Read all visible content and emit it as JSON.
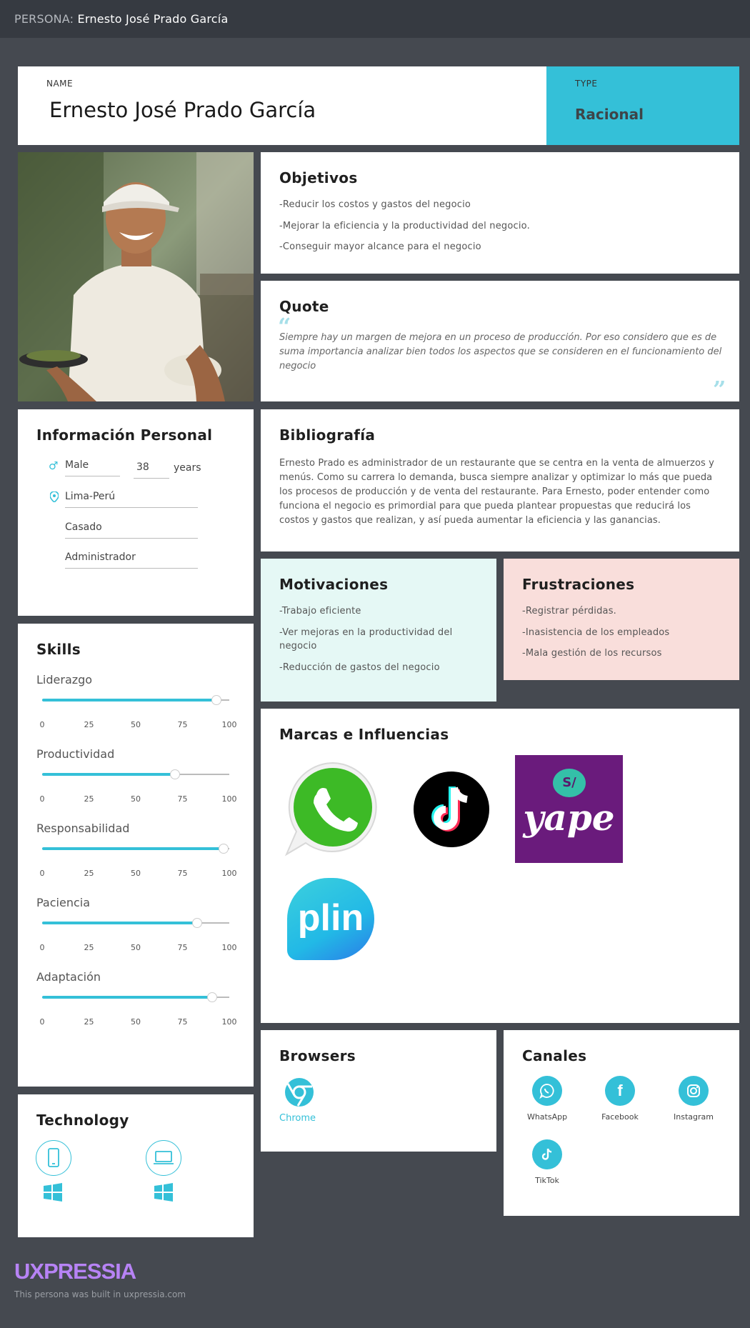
{
  "header": {
    "prefix": "PERSONA:",
    "persona_name": "Ernesto José Prado García"
  },
  "name_card": {
    "label": "NAME",
    "value": "Ernesto José Prado García"
  },
  "type_card": {
    "label": "TYPE",
    "value": "Racional",
    "color": "#34c0d8"
  },
  "objetivos": {
    "title": "Objetivos",
    "items": [
      "-Reducir los costos y gastos del negocio",
      "-Mejorar la eficiencia y la productividad del negocio.",
      "-Conseguir mayor alcance para el negocio"
    ]
  },
  "quote": {
    "title": "Quote",
    "text": "Siempre hay un margen de mejora en un proceso de producción. Por eso considero que es de suma importancia analizar bien todos los aspectos que se consideren en el funcionamiento del negocio"
  },
  "info": {
    "title": "Información Personal",
    "gender": "Male",
    "age": "38",
    "age_unit": "years",
    "location": "Lima-Perú",
    "marital_status": "Casado",
    "occupation": "Administrador"
  },
  "bio": {
    "title": "Bibliografía",
    "text": "Ernesto Prado es administrador de un restaurante que se centra en la venta de almuerzos y menús. Como su carrera lo demanda, busca siempre analizar y optimizar lo más que pueda los procesos de producción y de venta del restaurante. Para Ernesto, poder entender como funciona el negocio es primordial para que pueda plantear propuestas que reducirá los costos y gastos que realizan, y así pueda aumentar la eficiencia y las ganancias."
  },
  "motivaciones": {
    "title": "Motivaciones",
    "items": [
      "-Trabajo eficiente",
      "-Ver mejoras en la productividad del negocio",
      "-Reducción de gastos del negocio"
    ],
    "bg": "#e5f8f5"
  },
  "frustraciones": {
    "title": "Frustraciones",
    "items": [
      "-Registrar pérdidas.",
      "-Inasistencia de los empleados",
      "-Mala gestión de los recursos"
    ],
    "bg": "#f9dedb"
  },
  "skills": {
    "title": "Skills",
    "ticks": [
      "0",
      "25",
      "50",
      "75",
      "100"
    ],
    "items": [
      {
        "name": "Liderazgo",
        "value": 93
      },
      {
        "name": "Productividad",
        "value": 71
      },
      {
        "name": "Responsabilidad",
        "value": 97
      },
      {
        "name": "Paciencia",
        "value": 83
      },
      {
        "name": "Adaptación",
        "value": 91
      }
    ]
  },
  "brands": {
    "title": "Marcas e Influencias",
    "items": [
      "whatsapp-logo",
      "tiktok-logo",
      "yape-logo",
      "plin-logo"
    ],
    "yape_text": "yape",
    "yape_badge": "S/",
    "plin_text": "plin"
  },
  "technology": {
    "title": "Technology",
    "devices": [
      "mobile-icon",
      "laptop-icon"
    ],
    "os": [
      "windows-icon",
      "windows-icon"
    ]
  },
  "browsers": {
    "title": "Browsers",
    "items": [
      {
        "label": "Chrome",
        "icon": "chrome-icon"
      }
    ]
  },
  "canales": {
    "title": "Canales",
    "items": [
      {
        "label": "WhatsApp",
        "icon": "whatsapp-icon"
      },
      {
        "label": "Facebook",
        "icon": "facebook-icon"
      },
      {
        "label": "Instagram",
        "icon": "instagram-icon"
      },
      {
        "label": "TikTok",
        "icon": "tiktok-icon"
      }
    ]
  },
  "footer": {
    "brand": "UXPRESSIA",
    "note": "This persona was built in uxpressia.com"
  },
  "colors": {
    "accent": "#34c0d8",
    "background": "#454950",
    "brand": "#b783f5"
  }
}
